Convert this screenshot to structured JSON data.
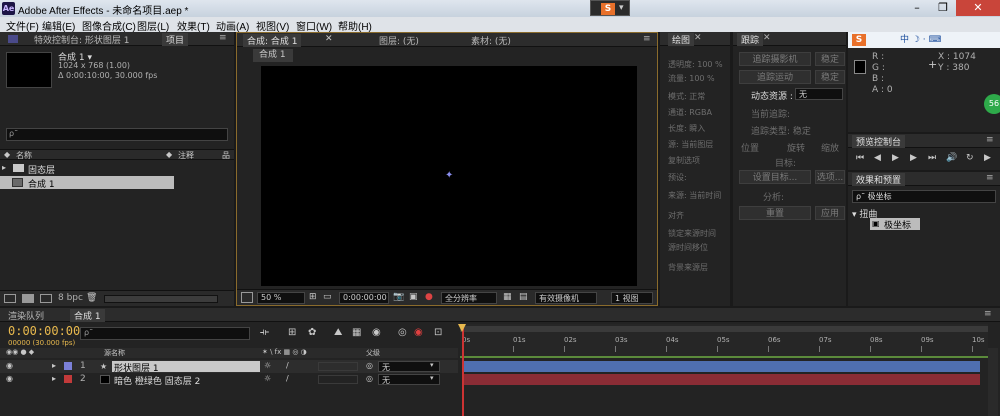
{
  "window": {
    "app_icon": "Ae",
    "title": "Adobe After Effects - 未命名项目.aep *",
    "ime_label": "S",
    "min": "–",
    "max": "❐",
    "close": "✕"
  },
  "menu": [
    "文件(F)",
    "编辑(E)",
    "图像合成(C)",
    "图层(L)",
    "效果(T)",
    "动画(A)",
    "视图(V)",
    "窗口(W)",
    "帮助(H)"
  ],
  "project": {
    "tab_effects": "特效控制台: 形状图层 1",
    "tab_project": "项目",
    "comp_name": "合成 1 ▾",
    "comp_size": "1024 x 768 (1.00)",
    "comp_duration": "Δ 0:00:10:00, 30.000 fps",
    "search_placeholder": "ρ˜",
    "col_name": "名称",
    "col_note": "注释",
    "items": [
      {
        "name": "固态层",
        "kind": "folder"
      },
      {
        "name": "合成 1",
        "kind": "comp"
      }
    ],
    "bpc": "8 bpc"
  },
  "viewer": {
    "tab_comp": "合成: 合成 1",
    "tab_layer": "图层: (无)",
    "tab_footage": "素材: (无)",
    "comp_chip": "合成 1",
    "zoom": "50 %",
    "timecode": "0:00:00:00",
    "resolution": "全分辨率",
    "camera": "有效摄像机",
    "views": "1 视图"
  },
  "paint": {
    "tab": "绘图",
    "rows": [
      "透明度: 100 %",
      "流量: 100 %",
      "模式: 正常",
      "通道: RGBA",
      "长度: 瞬入",
      "源: 当前图层",
      "复制选项",
      "预设:",
      "来源: 当前时间",
      "对齐",
      "锁定来源时间",
      "源时间移位",
      "背景来源层"
    ]
  },
  "tracker": {
    "tab": "跟踪",
    "buttons": [
      "追踪摄影机",
      "稳定",
      "追踪运动",
      "稳定",
      "设置目标...",
      "选项...",
      "重置",
      "应用"
    ],
    "motion_source_label": "动态资源 :",
    "motion_source_value": "无",
    "current_track": "当前追踪:",
    "track_type": "追踪类型: 稳定",
    "position": "位置",
    "rotation": "旋转",
    "scale": "缩放",
    "target": "目标:",
    "analyze": "分析:"
  },
  "info": {
    "ime": "中 ☽ · ⌨",
    "r": "R :",
    "g": "G :",
    "b": "B :",
    "a": "A : 0",
    "x": "X : 1074",
    "y": "Y : 380",
    "badge": "56"
  },
  "preview": {
    "title": "预览控制台"
  },
  "effects": {
    "title": "效果和预置",
    "search": "ρ˜ 极坐标",
    "category": "▾ 扭曲",
    "item": "极坐标"
  },
  "timeline": {
    "tab_render": "渲染队列",
    "tab_comp": "合成 1",
    "timecode": "0:00:00:00",
    "timecode_sub": "00000 (30.000 fps)",
    "search_placeholder": "ρ˜",
    "col_name": "源名称",
    "col_parent": "父级",
    "ruler": [
      "0s",
      "01s",
      "02s",
      "03s",
      "04s",
      "05s",
      "06s",
      "07s",
      "08s",
      "09s",
      "10s"
    ],
    "layers": [
      {
        "num": "1",
        "name": "形状图层 1",
        "parent": "无",
        "color": "#7b80d8",
        "bar": "#4f6fb0"
      },
      {
        "num": "2",
        "name": "暗色 橙绿色 固态层 2",
        "parent": "无",
        "color": "#c23a3a",
        "bar": "#8a2c35"
      }
    ]
  }
}
